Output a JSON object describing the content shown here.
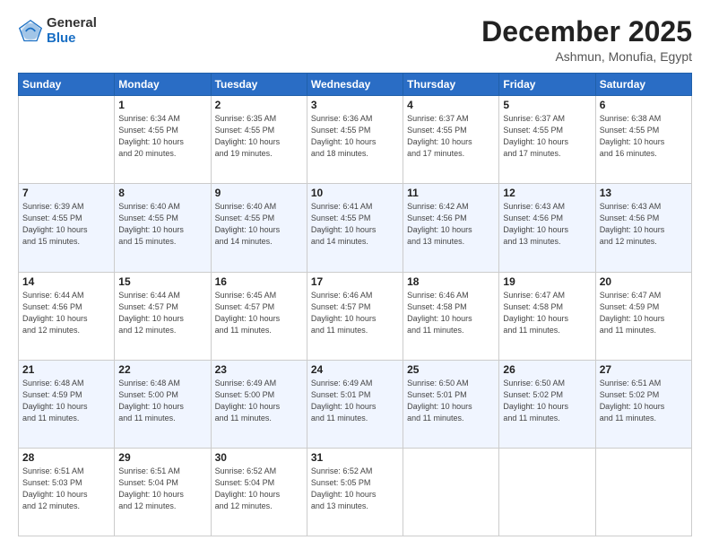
{
  "header": {
    "logo_line1": "General",
    "logo_line2": "Blue",
    "month": "December 2025",
    "location": "Ashmun, Monufia, Egypt"
  },
  "days_of_week": [
    "Sunday",
    "Monday",
    "Tuesday",
    "Wednesday",
    "Thursday",
    "Friday",
    "Saturday"
  ],
  "weeks": [
    [
      {
        "day": "",
        "info": ""
      },
      {
        "day": "1",
        "info": "Sunrise: 6:34 AM\nSunset: 4:55 PM\nDaylight: 10 hours\nand 20 minutes."
      },
      {
        "day": "2",
        "info": "Sunrise: 6:35 AM\nSunset: 4:55 PM\nDaylight: 10 hours\nand 19 minutes."
      },
      {
        "day": "3",
        "info": "Sunrise: 6:36 AM\nSunset: 4:55 PM\nDaylight: 10 hours\nand 18 minutes."
      },
      {
        "day": "4",
        "info": "Sunrise: 6:37 AM\nSunset: 4:55 PM\nDaylight: 10 hours\nand 17 minutes."
      },
      {
        "day": "5",
        "info": "Sunrise: 6:37 AM\nSunset: 4:55 PM\nDaylight: 10 hours\nand 17 minutes."
      },
      {
        "day": "6",
        "info": "Sunrise: 6:38 AM\nSunset: 4:55 PM\nDaylight: 10 hours\nand 16 minutes."
      }
    ],
    [
      {
        "day": "7",
        "info": "Sunrise: 6:39 AM\nSunset: 4:55 PM\nDaylight: 10 hours\nand 15 minutes."
      },
      {
        "day": "8",
        "info": "Sunrise: 6:40 AM\nSunset: 4:55 PM\nDaylight: 10 hours\nand 15 minutes."
      },
      {
        "day": "9",
        "info": "Sunrise: 6:40 AM\nSunset: 4:55 PM\nDaylight: 10 hours\nand 14 minutes."
      },
      {
        "day": "10",
        "info": "Sunrise: 6:41 AM\nSunset: 4:55 PM\nDaylight: 10 hours\nand 14 minutes."
      },
      {
        "day": "11",
        "info": "Sunrise: 6:42 AM\nSunset: 4:56 PM\nDaylight: 10 hours\nand 13 minutes."
      },
      {
        "day": "12",
        "info": "Sunrise: 6:43 AM\nSunset: 4:56 PM\nDaylight: 10 hours\nand 13 minutes."
      },
      {
        "day": "13",
        "info": "Sunrise: 6:43 AM\nSunset: 4:56 PM\nDaylight: 10 hours\nand 12 minutes."
      }
    ],
    [
      {
        "day": "14",
        "info": "Sunrise: 6:44 AM\nSunset: 4:56 PM\nDaylight: 10 hours\nand 12 minutes."
      },
      {
        "day": "15",
        "info": "Sunrise: 6:44 AM\nSunset: 4:57 PM\nDaylight: 10 hours\nand 12 minutes."
      },
      {
        "day": "16",
        "info": "Sunrise: 6:45 AM\nSunset: 4:57 PM\nDaylight: 10 hours\nand 11 minutes."
      },
      {
        "day": "17",
        "info": "Sunrise: 6:46 AM\nSunset: 4:57 PM\nDaylight: 10 hours\nand 11 minutes."
      },
      {
        "day": "18",
        "info": "Sunrise: 6:46 AM\nSunset: 4:58 PM\nDaylight: 10 hours\nand 11 minutes."
      },
      {
        "day": "19",
        "info": "Sunrise: 6:47 AM\nSunset: 4:58 PM\nDaylight: 10 hours\nand 11 minutes."
      },
      {
        "day": "20",
        "info": "Sunrise: 6:47 AM\nSunset: 4:59 PM\nDaylight: 10 hours\nand 11 minutes."
      }
    ],
    [
      {
        "day": "21",
        "info": "Sunrise: 6:48 AM\nSunset: 4:59 PM\nDaylight: 10 hours\nand 11 minutes."
      },
      {
        "day": "22",
        "info": "Sunrise: 6:48 AM\nSunset: 5:00 PM\nDaylight: 10 hours\nand 11 minutes."
      },
      {
        "day": "23",
        "info": "Sunrise: 6:49 AM\nSunset: 5:00 PM\nDaylight: 10 hours\nand 11 minutes."
      },
      {
        "day": "24",
        "info": "Sunrise: 6:49 AM\nSunset: 5:01 PM\nDaylight: 10 hours\nand 11 minutes."
      },
      {
        "day": "25",
        "info": "Sunrise: 6:50 AM\nSunset: 5:01 PM\nDaylight: 10 hours\nand 11 minutes."
      },
      {
        "day": "26",
        "info": "Sunrise: 6:50 AM\nSunset: 5:02 PM\nDaylight: 10 hours\nand 11 minutes."
      },
      {
        "day": "27",
        "info": "Sunrise: 6:51 AM\nSunset: 5:02 PM\nDaylight: 10 hours\nand 11 minutes."
      }
    ],
    [
      {
        "day": "28",
        "info": "Sunrise: 6:51 AM\nSunset: 5:03 PM\nDaylight: 10 hours\nand 12 minutes."
      },
      {
        "day": "29",
        "info": "Sunrise: 6:51 AM\nSunset: 5:04 PM\nDaylight: 10 hours\nand 12 minutes."
      },
      {
        "day": "30",
        "info": "Sunrise: 6:52 AM\nSunset: 5:04 PM\nDaylight: 10 hours\nand 12 minutes."
      },
      {
        "day": "31",
        "info": "Sunrise: 6:52 AM\nSunset: 5:05 PM\nDaylight: 10 hours\nand 13 minutes."
      },
      {
        "day": "",
        "info": ""
      },
      {
        "day": "",
        "info": ""
      },
      {
        "day": "",
        "info": ""
      }
    ]
  ]
}
